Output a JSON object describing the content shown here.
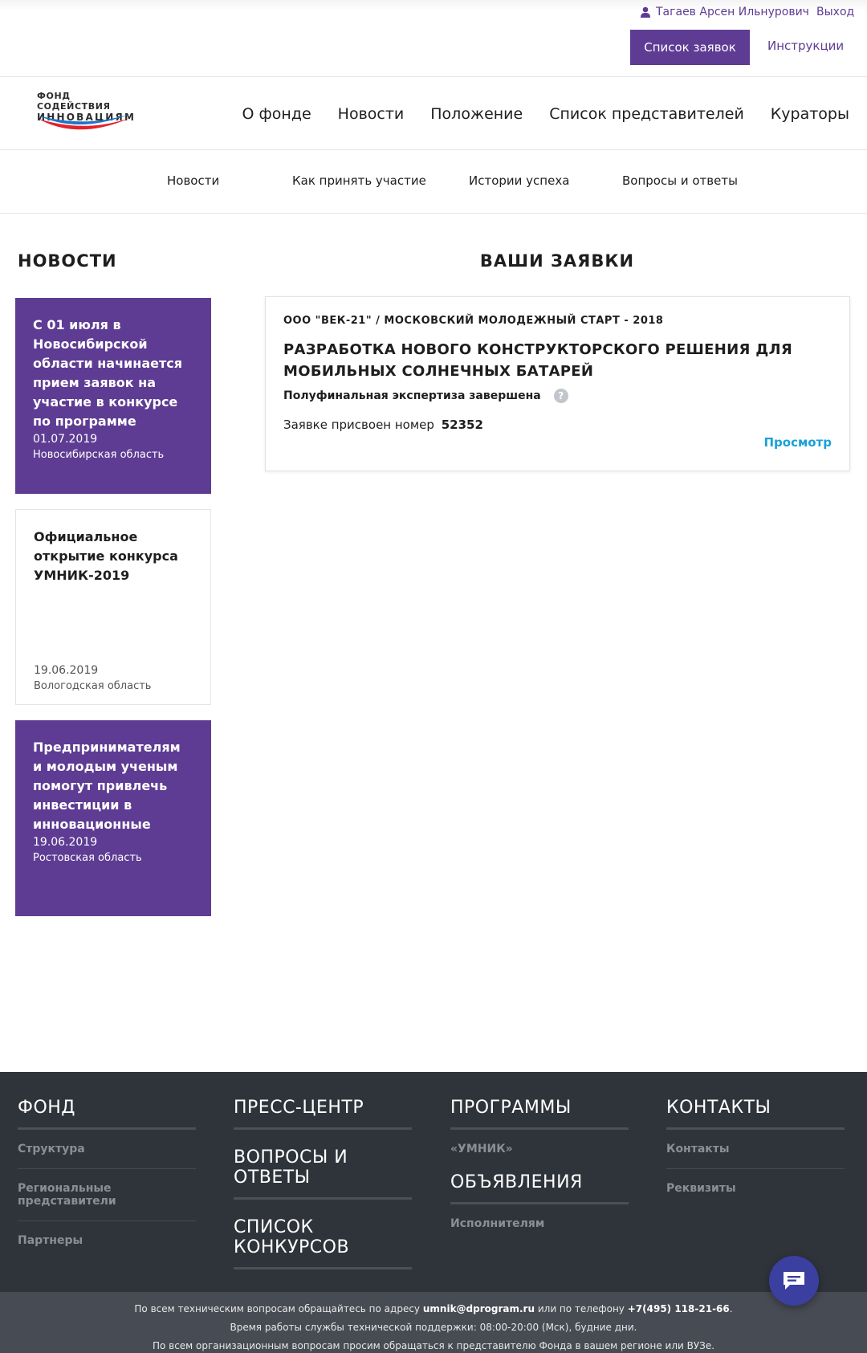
{
  "topbar": {
    "user_name": "Тагаев Арсен Ильнурович",
    "logout_label": "Выход",
    "applications_button": "Список заявок",
    "instructions_label": "Инструкции"
  },
  "logo": {
    "line1": "ФОНД СОДЕЙСТВИЯ",
    "line2": "ИННОВАЦИЯМ"
  },
  "main_nav": [
    "О фонде",
    "Новости",
    "Положение",
    "Список представителей",
    "Кураторы"
  ],
  "sub_nav": [
    "Новости",
    "Как принять участие",
    "Истории успеха",
    "Вопросы и ответы"
  ],
  "news": {
    "heading": "НОВОСТИ",
    "items": [
      {
        "title": "С 01 июля в Новосибирской области начинается прием заявок на участие в конкурсе по программе",
        "date": "01.07.2019",
        "region": "Новосибирская область"
      },
      {
        "title": "Официальное открытие конкурса УМНИК-2019",
        "date": "19.06.2019",
        "region": "Вологодская область"
      },
      {
        "title": "Предпринимателям и молодым ученым помогут привлечь инвестиции в инновационные",
        "date": "19.06.2019",
        "region": "Ростовская область"
      }
    ]
  },
  "applications": {
    "heading": "ВАШИ ЗАЯВКИ",
    "items": [
      {
        "org": "ООО \"ВЕК-21\" / МОСКОВСКИЙ МОЛОДЕЖНЫЙ СТАРТ - 2018",
        "name": "РАЗРАБОТКА НОВОГО КОНСТРУКТОРСКОГО РЕШЕНИЯ ДЛЯ МОБИЛЬНЫХ СОЛНЕЧНЫХ БАТАРЕЙ",
        "status": "Полуфинальная экспертиза завершена",
        "number_label": "Заявке присвоен номер",
        "number": "52352",
        "view_label": "Просмотр"
      }
    ]
  },
  "footer": {
    "fond": {
      "heading": "ФОНД",
      "links": [
        "Структура",
        "Региональные представители",
        "Партнеры"
      ]
    },
    "press": {
      "headings": [
        "ПРЕСС-ЦЕНТР",
        "ВОПРОСЫ И ОТВЕТЫ",
        "СПИСОК КОНКУРСОВ"
      ]
    },
    "programs": {
      "heading": "ПРОГРАММЫ",
      "links": [
        "«УМНИК»"
      ],
      "heading2": "ОБЪЯВЛЕНИЯ",
      "links2": [
        "Исполнителям"
      ]
    },
    "contacts": {
      "heading": "КОНТАКТЫ",
      "links": [
        "Контакты",
        "Реквизиты"
      ]
    },
    "bottom": {
      "line1_prefix": "По всем техническим вопросам обращайтесь по адресу",
      "email": "umnik@dprogram.ru",
      "line1_mid": "или по телефону",
      "phone": "+7(495) 118-21-66",
      "line1_suffix": ".",
      "line2": "Время работы службы технической поддержки: 08:00-20:00 (Мск), будние дни.",
      "line3": "По всем организационным вопросам просим обращаться к представителю Фонда в вашем регионе или ВУЗе."
    }
  },
  "colors": {
    "brand_purple": "#5e3c93",
    "link_blue": "#1aa0d8",
    "footer_bg": "#2f343b",
    "bottom_bar_bg": "#474b53",
    "chat_button": "#3a3fa0"
  },
  "icons": {
    "user": "user-icon",
    "help": "help-icon",
    "chat": "chat-icon"
  }
}
